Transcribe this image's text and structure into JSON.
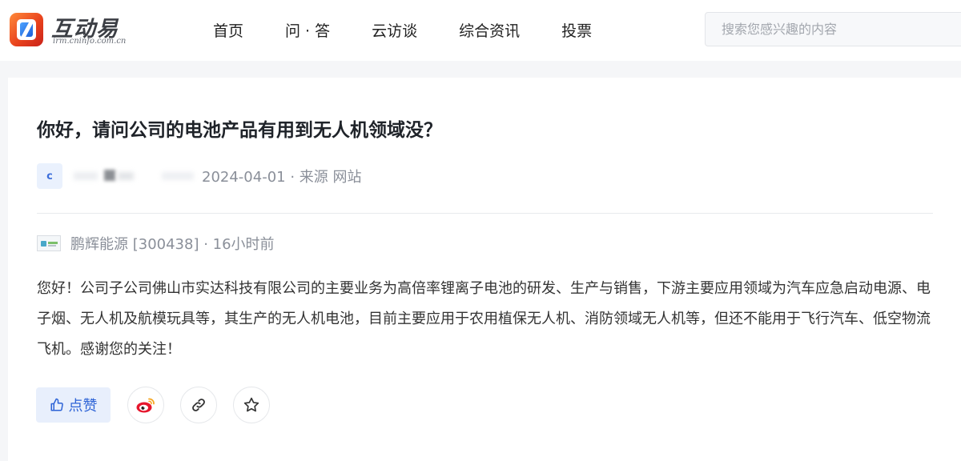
{
  "header": {
    "logo_title": "互动易",
    "logo_subtitle": "irm.cninfo.com.cn",
    "nav": [
      {
        "label": "首页"
      },
      {
        "label": "问 · 答"
      },
      {
        "label": "云访谈"
      },
      {
        "label": "综合资讯"
      },
      {
        "label": "投票"
      }
    ],
    "search": {
      "placeholder": "搜索您感兴趣的内容",
      "value": ""
    }
  },
  "question": {
    "title": "你好，请问公司的电池产品有用到无人机领域没？",
    "asker_avatar_letter": "c",
    "meta": "2024-04-01 · 来源 网站"
  },
  "answer": {
    "company_line": "鹏辉能源 [300438] · 16小时前",
    "text": "您好！公司子公司佛山市实达科技有限公司的主要业务为高倍率锂离子电池的研发、生产与销售，下游主要应用领域为汽车应急启动电源、电子烟、无人机及航模玩具等，其生产的无人机电池，目前主要应用于农用植保无人机、消防领域无人机等，但还不能用于飞行汽车、低空物流飞机。感谢您的关注！"
  },
  "actions": {
    "like_label": "点赞",
    "icons": [
      "thumbs-up-icon",
      "weibo-icon",
      "link-icon",
      "star-icon"
    ]
  },
  "colors": {
    "accent": "#2d63d6",
    "logo_orange": "#e9431d",
    "muted_text": "#8a8f99"
  }
}
